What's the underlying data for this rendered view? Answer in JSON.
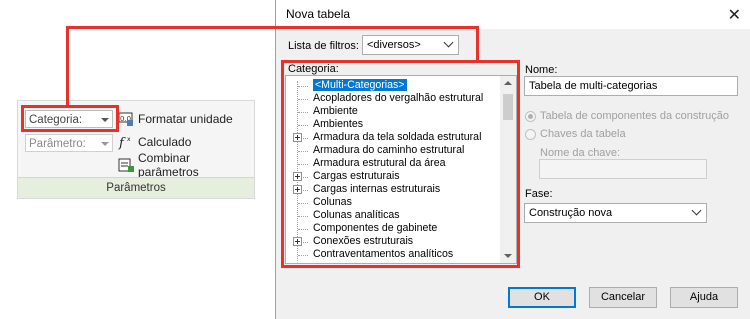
{
  "ribbon": {
    "category_combo": "Categoria:",
    "parameter_combo": "Parâmetro:",
    "format_unit": "Formatar  unidade",
    "calculated": "Calculado",
    "combine_params": "Combinar  parâmetros",
    "footer": "Parâmetros"
  },
  "dialog": {
    "title": "Nova tabela",
    "filters_label": "Lista de filtros:",
    "filters_value": "<diversos>",
    "category_label": "Categoria:",
    "categories": [
      "<Multi-Categorias>",
      "Acopladores do vergalhão estrutural",
      "Ambiente",
      "Ambientes",
      "Armadura da tela soldada estrutural",
      "Armadura do caminho estrutural",
      "Armadura estrutural da área",
      "Cargas estruturais",
      "Cargas internas estruturais",
      "Colunas",
      "Colunas analíticas",
      "Componentes de gabinete",
      "Conexões estruturais",
      "Contraventamentos analíticos"
    ],
    "name_label": "Nome:",
    "name_value": "Tabela de multi-categorias",
    "radio_components": "Tabela de componentes da construção",
    "radio_keys": "Chaves da tabela",
    "key_name_label": "Nome da chave:",
    "phase_label": "Fase:",
    "phase_value": "Construção nova",
    "ok": "OK",
    "cancel": "Cancelar",
    "help": "Ajuda"
  },
  "colors": {
    "highlight": "#e8312a",
    "selection": "#0078d7",
    "ribbon_footer": "#e6efdd"
  }
}
